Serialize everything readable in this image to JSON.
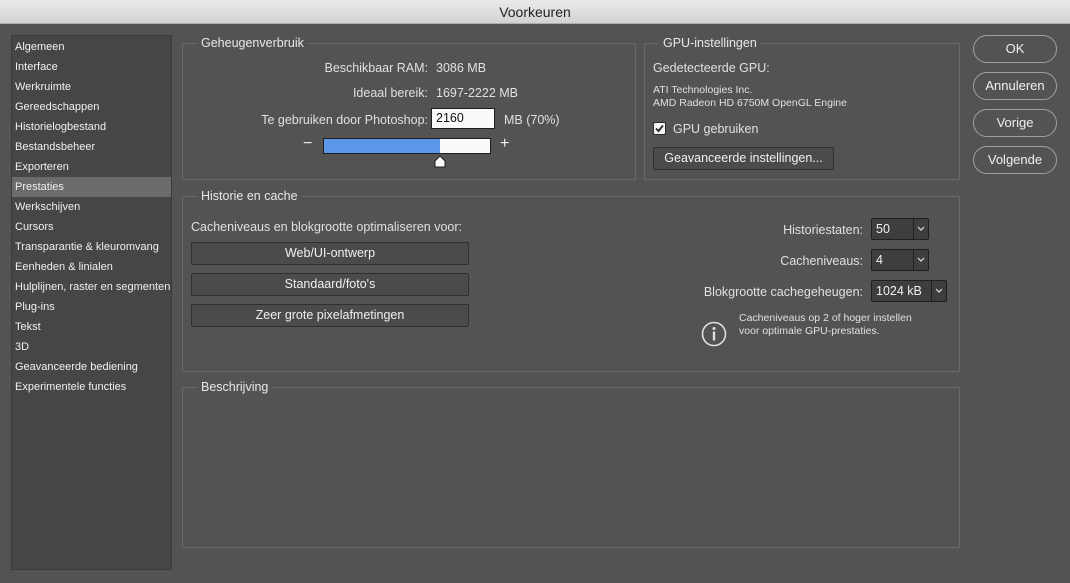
{
  "window": {
    "title": "Voorkeuren"
  },
  "sidebar": {
    "items": [
      {
        "label": "Algemeen"
      },
      {
        "label": "Interface"
      },
      {
        "label": "Werkruimte"
      },
      {
        "label": "Gereedschappen"
      },
      {
        "label": "Historielogbestand"
      },
      {
        "label": "Bestandsbeheer"
      },
      {
        "label": "Exporteren"
      },
      {
        "label": "Prestaties",
        "selected": true
      },
      {
        "label": "Werkschijven"
      },
      {
        "label": "Cursors"
      },
      {
        "label": "Transparantie & kleuromvang"
      },
      {
        "label": "Eenheden & linialen"
      },
      {
        "label": "Hulplijnen, raster en segmenten"
      },
      {
        "label": "Plug-ins"
      },
      {
        "label": "Tekst"
      },
      {
        "label": "3D"
      },
      {
        "label": "Geavanceerde bediening"
      },
      {
        "label": "Experimentele functies"
      }
    ]
  },
  "memory": {
    "title": "Geheugenverbruik",
    "available_label": "Beschikbaar RAM:",
    "available_value": "3086 MB",
    "ideal_label": "Ideaal bereik:",
    "ideal_value": "1697-2222 MB",
    "use_label": "Te gebruiken door Photoshop:",
    "use_value": "2160",
    "use_unit": "MB (70%)",
    "slider_fraction": 0.7,
    "minus": "−",
    "plus": "+"
  },
  "gpu": {
    "title": "GPU-instellingen",
    "detected_label": "Gedetecteerde GPU:",
    "vendor": "ATI Technologies Inc.",
    "model": "AMD Radeon HD 6750M OpenGL Engine",
    "use_gpu_label": "GPU gebruiken",
    "use_gpu_checked": true,
    "advanced_button": "Geavanceerde instellingen..."
  },
  "history": {
    "title": "Historie en cache",
    "optimize_label": "Cacheniveaus en blokgrootte optimaliseren voor:",
    "preset_buttons": [
      "Web/UI-ontwerp",
      "Standaard/foto's",
      "Zeer grote pixelafmetingen"
    ],
    "states_label": "Historiestaten:",
    "states_value": "50",
    "levels_label": "Cacheniveaus:",
    "levels_value": "4",
    "tile_label": "Blokgrootte cachegeheugen:",
    "tile_value": "1024 kB",
    "info_line1": "Cacheniveaus op 2 of hoger instellen",
    "info_line2": "voor optimale GPU-prestaties."
  },
  "description": {
    "title": "Beschrijving"
  },
  "buttons": {
    "ok": "OK",
    "cancel": "Annuleren",
    "prev": "Vorige",
    "next": "Volgende"
  },
  "colors": {
    "accent": "#5b97e8",
    "background": "#535353",
    "panel": "#464646"
  },
  "icons": {
    "checkbox": "check-icon",
    "info": "info-icon",
    "caret": "chevron-down-icon"
  }
}
